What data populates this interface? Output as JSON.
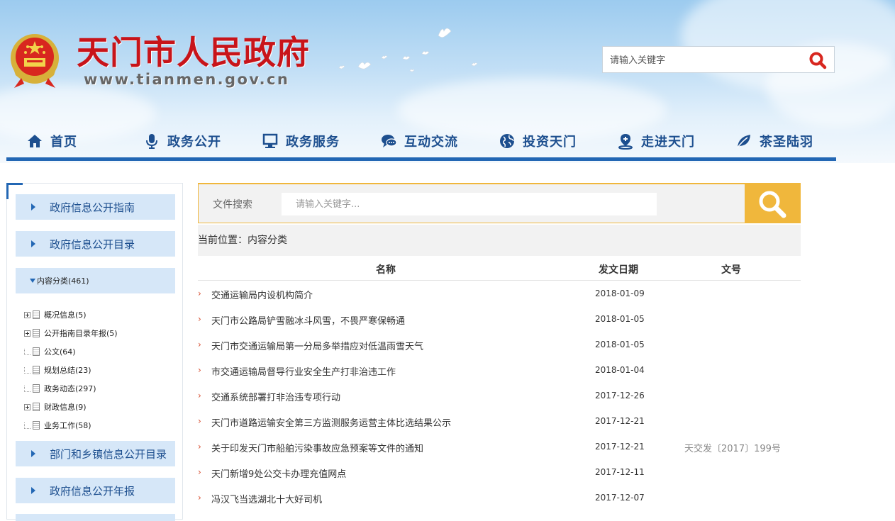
{
  "header": {
    "site_title": "天门市人民政府",
    "site_url": "www.tianmen.gov.cn",
    "search_placeholder": "请输入关键字"
  },
  "nav": [
    {
      "label": "首页",
      "icon": "home-icon"
    },
    {
      "label": "政务公开",
      "icon": "microphone-icon"
    },
    {
      "label": "政务服务",
      "icon": "monitor-icon"
    },
    {
      "label": "互动交流",
      "icon": "chat-icon"
    },
    {
      "label": "投资天门",
      "icon": "globe-icon"
    },
    {
      "label": "走进天门",
      "icon": "map-pin-icon"
    },
    {
      "label": "茶圣陆羽",
      "icon": "leaf-icon"
    }
  ],
  "sidebar": {
    "guide": "政府信息公开指南",
    "catalog": "政府信息公开目录",
    "content_category": "内容分类(461)",
    "tree": [
      {
        "label": "概况信息(5)",
        "expandable": true
      },
      {
        "label": "公开指南目录年报(5)",
        "expandable": true
      },
      {
        "label": "公文(64)",
        "expandable": false
      },
      {
        "label": "规划总结(23)",
        "expandable": false
      },
      {
        "label": "政务动态(297)",
        "expandable": false
      },
      {
        "label": "财政信息(9)",
        "expandable": true
      },
      {
        "label": "业务工作(58)",
        "expandable": false
      }
    ],
    "dept_catalog": "部门和乡镇信息公开目录",
    "annual_report": "政府信息公开年报"
  },
  "file_search": {
    "label": "文件搜索",
    "placeholder": "请输入关键字..."
  },
  "breadcrumb": "当前位置：内容分类",
  "table": {
    "headers": {
      "name": "名称",
      "date": "发文日期",
      "number": "文号"
    },
    "rows": [
      {
        "title": "交通运输局内设机构简介",
        "date": "2018-01-09",
        "number": ""
      },
      {
        "title": "天门市公路局铲雪融冰斗风雪，不畏严寒保畅通",
        "date": "2018-01-05",
        "number": ""
      },
      {
        "title": "天门市交通运输局第一分局多举措应对低温雨雪天气",
        "date": "2018-01-05",
        "number": ""
      },
      {
        "title": "市交通运输局督导行业安全生产打非治违工作",
        "date": "2018-01-04",
        "number": ""
      },
      {
        "title": "交通系统部署打非治违专项行动",
        "date": "2017-12-26",
        "number": ""
      },
      {
        "title": "天门市道路运输安全第三方监测服务运营主体比选结果公示",
        "date": "2017-12-21",
        "number": ""
      },
      {
        "title": "关于印发天门市船舶污染事故应急预案等文件的通知",
        "date": "2017-12-21",
        "number": "天交发〔2017〕199号"
      },
      {
        "title": "天门新增9处公交卡办理充值网点",
        "date": "2017-12-11",
        "number": ""
      },
      {
        "title": "冯汉飞当选湖北十大好司机",
        "date": "2017-12-07",
        "number": ""
      }
    ]
  },
  "colors": {
    "title_red": "#c8141a",
    "nav_blue": "#1d4f8f",
    "bar_blue": "#2367b4",
    "search_orange": "#f0b73c"
  }
}
